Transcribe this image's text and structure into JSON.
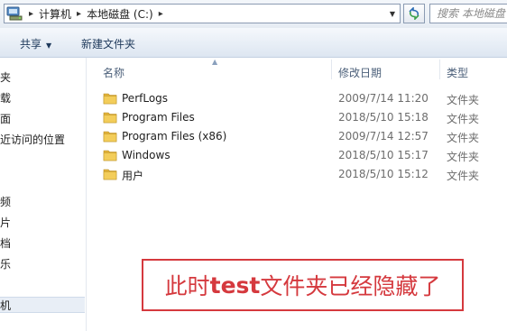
{
  "address_bar": {
    "icon": "computer-drive-icon",
    "crumbs": [
      "计算机",
      "本地磁盘 (C:)"
    ]
  },
  "search": {
    "placeholder": "搜索 本地磁盘 (C:)"
  },
  "toolbar": {
    "share_label": "共享",
    "new_folder_label": "新建文件夹"
  },
  "nav": {
    "items": [
      "夹",
      "载",
      "面",
      "近访问的位置",
      "频",
      "片",
      "档",
      "乐",
      "机"
    ]
  },
  "columns": {
    "name": "名称",
    "modified": "修改日期",
    "type": "类型"
  },
  "files": [
    {
      "name": "PerfLogs",
      "date": "2009/7/14 11:20",
      "type": "文件夹"
    },
    {
      "name": "Program Files",
      "date": "2018/5/10 15:18",
      "type": "文件夹"
    },
    {
      "name": "Program Files (x86)",
      "date": "2009/7/14 12:57",
      "type": "文件夹"
    },
    {
      "name": "Windows",
      "date": "2018/5/10 15:17",
      "type": "文件夹"
    },
    {
      "name": "用户",
      "date": "2018/5/10 15:12",
      "type": "文件夹"
    }
  ],
  "annotation": {
    "pre": "此时",
    "bold": "test",
    "post": "文件夹已经隐藏了"
  },
  "colors": {
    "annotation_red": "#d5393e",
    "folder_yellow": "#f3cd5a"
  }
}
